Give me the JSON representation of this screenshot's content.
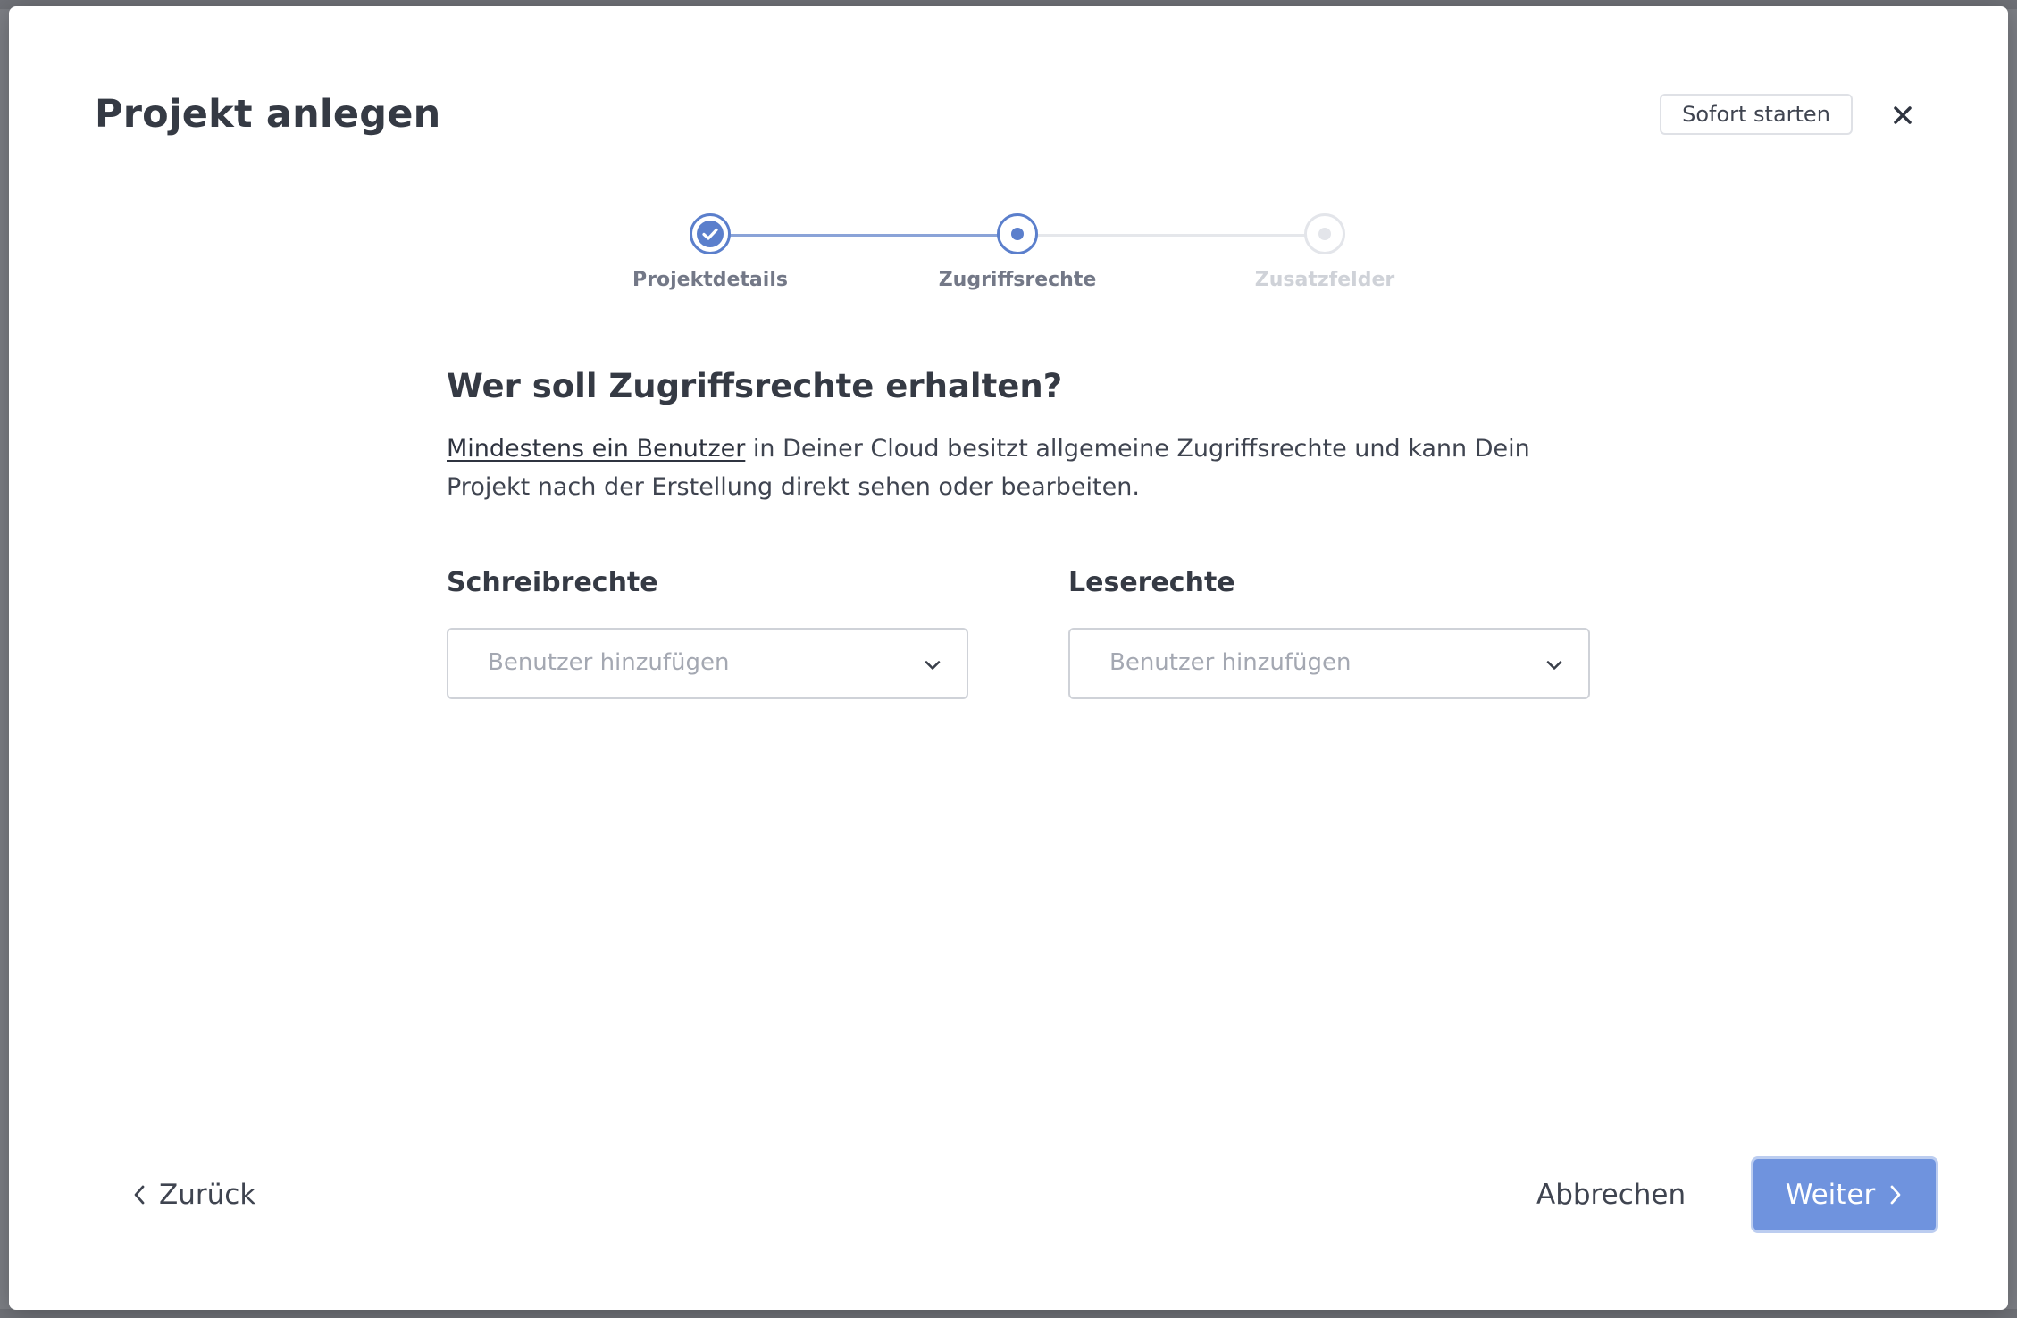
{
  "modal": {
    "title": "Projekt anlegen",
    "quick_start_label": "Sofort starten",
    "close_icon": "close-icon"
  },
  "stepper": {
    "steps": [
      {
        "label": "Projektdetails",
        "state": "completed"
      },
      {
        "label": "Zugriffsrechte",
        "state": "current"
      },
      {
        "label": "Zusatzfelder",
        "state": "upcoming"
      }
    ]
  },
  "content": {
    "heading": "Wer soll Zugriffsrechte erhalten?",
    "description_link": "Mindestens ein Benutzer",
    "description_rest": " in Deiner Cloud besitzt allgemeine Zugriffsrechte und kann Dein Projekt nach der Erstellung direkt sehen oder bearbeiten.",
    "write_label": "Schreibrechte",
    "write_placeholder": "Benutzer hinzufügen",
    "read_label": "Leserechte",
    "read_placeholder": "Benutzer hinzufügen"
  },
  "footer": {
    "back_label": "Zurück",
    "cancel_label": "Abbrechen",
    "next_label": "Weiter"
  },
  "colors": {
    "accent": "#5b7fcc",
    "primary_button": "#6f93de",
    "inactive_step": "#e3e5ea"
  }
}
